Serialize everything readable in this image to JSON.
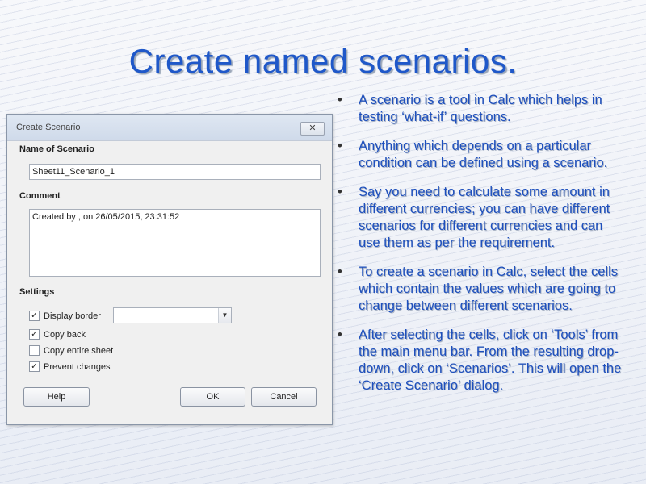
{
  "slide": {
    "title": "Create named scenarios.",
    "bullets": [
      "A scenario is a tool in Calc which helps in testing ‘what-if’ questions.",
      "Anything which depends on a particular condition can be defined using a scenario.",
      "Say you need to calculate some amount in different currencies; you can have different scenarios for different currencies and can use them as per the requirement.",
      "To create a scenario in Calc, select the cells which contain the values which are going to change between different scenarios.",
      "After selecting the cells, click on ‘Tools’ from the main menu bar. From the resulting drop-down, click on ‘Scenarios’. This will open the ‘Create Scenario’ dialog."
    ],
    "bullet_symbol": "•"
  },
  "dialog": {
    "title": "Create Scenario",
    "close_glyph": "✕",
    "name_label": "Name of Scenario",
    "name_value": "Sheet11_Scenario_1",
    "comment_label": "Comment",
    "comment_value": "Created by  , on 26/05/2015, 23:31:52",
    "settings_label": "Settings",
    "checkboxes": [
      {
        "label": "Display border",
        "checked": true
      },
      {
        "label": "Copy back",
        "checked": true
      },
      {
        "label": "Copy entire sheet",
        "checked": false
      },
      {
        "label": "Prevent changes",
        "checked": true
      }
    ],
    "border_color_value": "",
    "buttons": {
      "help": "Help",
      "ok": "OK",
      "cancel": "Cancel"
    }
  },
  "colors": {
    "title": "#1f58c9",
    "bullet_text": "#1d4fbd"
  }
}
